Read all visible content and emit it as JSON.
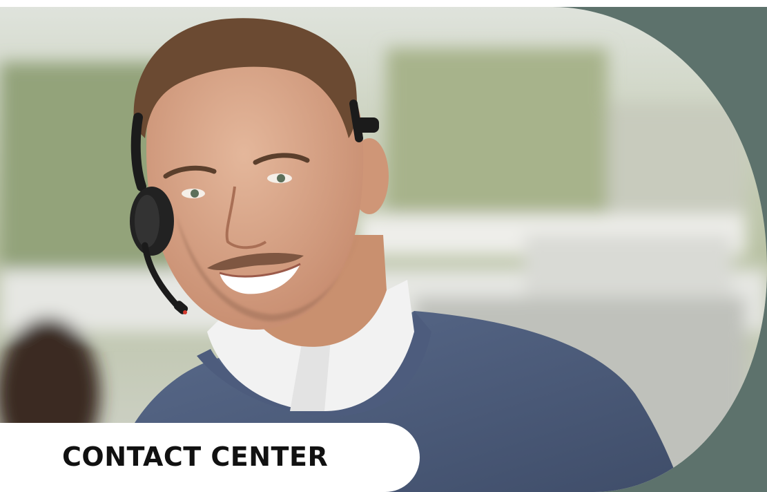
{
  "banner": {
    "label": "CONTACT CENTER"
  },
  "colors": {
    "panel": "#5d726c",
    "label_bg": "#ffffff",
    "label_text": "#111111",
    "sweater": "#4a5a7a",
    "shirt": "#f2f2f2",
    "skin": "#d9a88a",
    "hair": "#6b4a32",
    "headset": "#1b1b1b"
  },
  "image": {
    "subject": "smiling-man-with-headset-photo"
  }
}
